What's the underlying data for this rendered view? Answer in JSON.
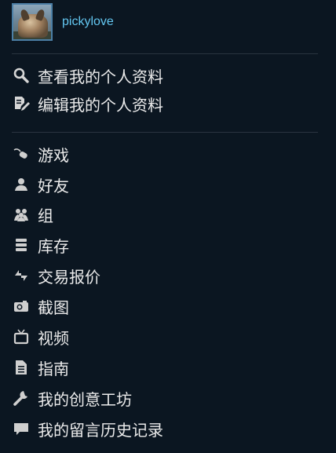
{
  "profile": {
    "username": "pickylove",
    "avatar_icon": "avatar-dog-photo"
  },
  "profile_links": [
    {
      "label": "查看我的个人资料",
      "icon": "search-icon"
    },
    {
      "label": "编辑我的个人资料",
      "icon": "edit-icon"
    }
  ],
  "nav_items": [
    {
      "label": "游戏",
      "icon": "game-icon"
    },
    {
      "label": "好友",
      "icon": "friend-icon"
    },
    {
      "label": "组",
      "icon": "group-icon"
    },
    {
      "label": "库存",
      "icon": "inventory-icon"
    },
    {
      "label": "交易报价",
      "icon": "trade-icon"
    },
    {
      "label": "截图",
      "icon": "camera-icon"
    },
    {
      "label": "视频",
      "icon": "tv-icon"
    },
    {
      "label": "指南",
      "icon": "document-icon"
    },
    {
      "label": "我的创意工坊",
      "icon": "wrench-icon"
    },
    {
      "label": "我的留言历史记录",
      "icon": "comment-icon"
    }
  ],
  "colors": {
    "background": "#0b1621",
    "username": "#63c6f0",
    "text": "#ebebeb",
    "icon": "#c9c9c9"
  }
}
